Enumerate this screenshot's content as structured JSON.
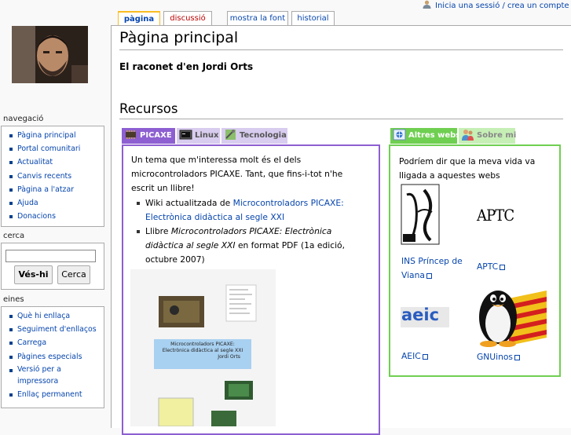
{
  "personal": {
    "login_link": "Inicia una sessió / crea un compte"
  },
  "tabs": [
    {
      "label": "pàgina"
    },
    {
      "label": "discussió"
    },
    {
      "label": "mostra la font"
    },
    {
      "label": "historial"
    }
  ],
  "sidebar": {
    "navigation": {
      "title": "navegació",
      "items": [
        "Pàgina principal",
        "Portal comunitari",
        "Actualitat",
        "Canvis recents",
        "Pàgina a l'atzar",
        "Ajuda",
        "Donacions"
      ]
    },
    "search": {
      "title": "cerca",
      "go_button": "Vés-hi",
      "search_button": "Cerca"
    },
    "tools": {
      "title": "eines",
      "items": [
        "Què hi enllaça",
        "Seguiment d'enllaços",
        "Carrega",
        "Pàgines especials",
        "Versió per a impressora",
        "Enllaç permanent"
      ]
    }
  },
  "content": {
    "title": "Pàgina principal",
    "subtitle": "El raconet d'en Jordi Orts",
    "section": "Recursos"
  },
  "left_portal": {
    "tabs": [
      "PICAXE",
      "Linux",
      "Tecnologia"
    ],
    "intro": "Un tema que m'interessa molt és el dels microcontroladors PICAXE. Tant, que fins-i-tot n'he escrit un llibre!",
    "bullet1_prefix": "Wiki actualitzada de",
    "bullet1_link": "Microcontroladors PICAXE: Electrònica didàctica al segle XXI",
    "bullet2_prefix": "Llibre",
    "bullet2_italic": "Microcontroladors PICAXE: Electrònica didàctica al segle XXI",
    "bullet2_suffix": "en format PDF (1a edició, octubre 2007)",
    "cover_line1": "Microcontroladors PICAXE:",
    "cover_line2": "Electrònica didàctica al segle XXI",
    "cover_author": "Jordi Orts"
  },
  "right_portal": {
    "tabs": [
      "Altres webs",
      "Sobre mi"
    ],
    "intro": "Podríem dir que la meva vida va lligada a aquestes webs",
    "links": [
      {
        "label": "INS Príncep de Viana"
      },
      {
        "label": "APTC"
      },
      {
        "label": "AEIC"
      },
      {
        "label": "GNUinos"
      }
    ],
    "logo_texts": {
      "aptc": "APTC",
      "aeic": "aeic"
    }
  },
  "colors": {
    "link": "#0645ad",
    "picaxe_border": "#8d5fd1",
    "webs_border": "#6fcf51",
    "tab_selected": "#fabd23"
  }
}
